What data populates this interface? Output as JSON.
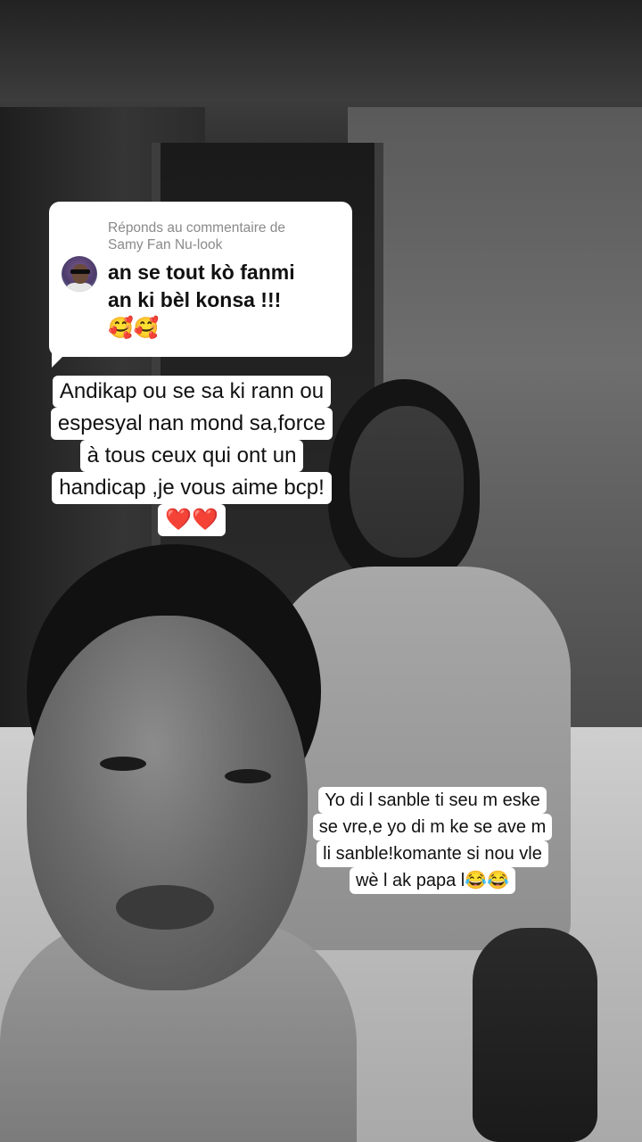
{
  "reply_card": {
    "header_line1": "Réponds au commentaire de",
    "header_line2": "Samy Fan Nu-look",
    "comment_line1": "an se tout kò fanmi",
    "comment_line2": "an ki bèl konsa !!!",
    "comment_line3": "🥰🥰"
  },
  "caption_top": {
    "lines": [
      "Andikap ou se sa ki rann ou",
      "espesyal nan mond sa,force",
      "à tous ceux qui ont un",
      "handicap ,je vous aime bcp!",
      "❤️❤️"
    ]
  },
  "caption_bottom": {
    "lines": [
      "Yo di l sanble ti seu m eske",
      "se vre,e yo di m ke se ave m",
      "li sanble!komante si nou vle",
      "wè l ak papa l😂😂"
    ]
  }
}
